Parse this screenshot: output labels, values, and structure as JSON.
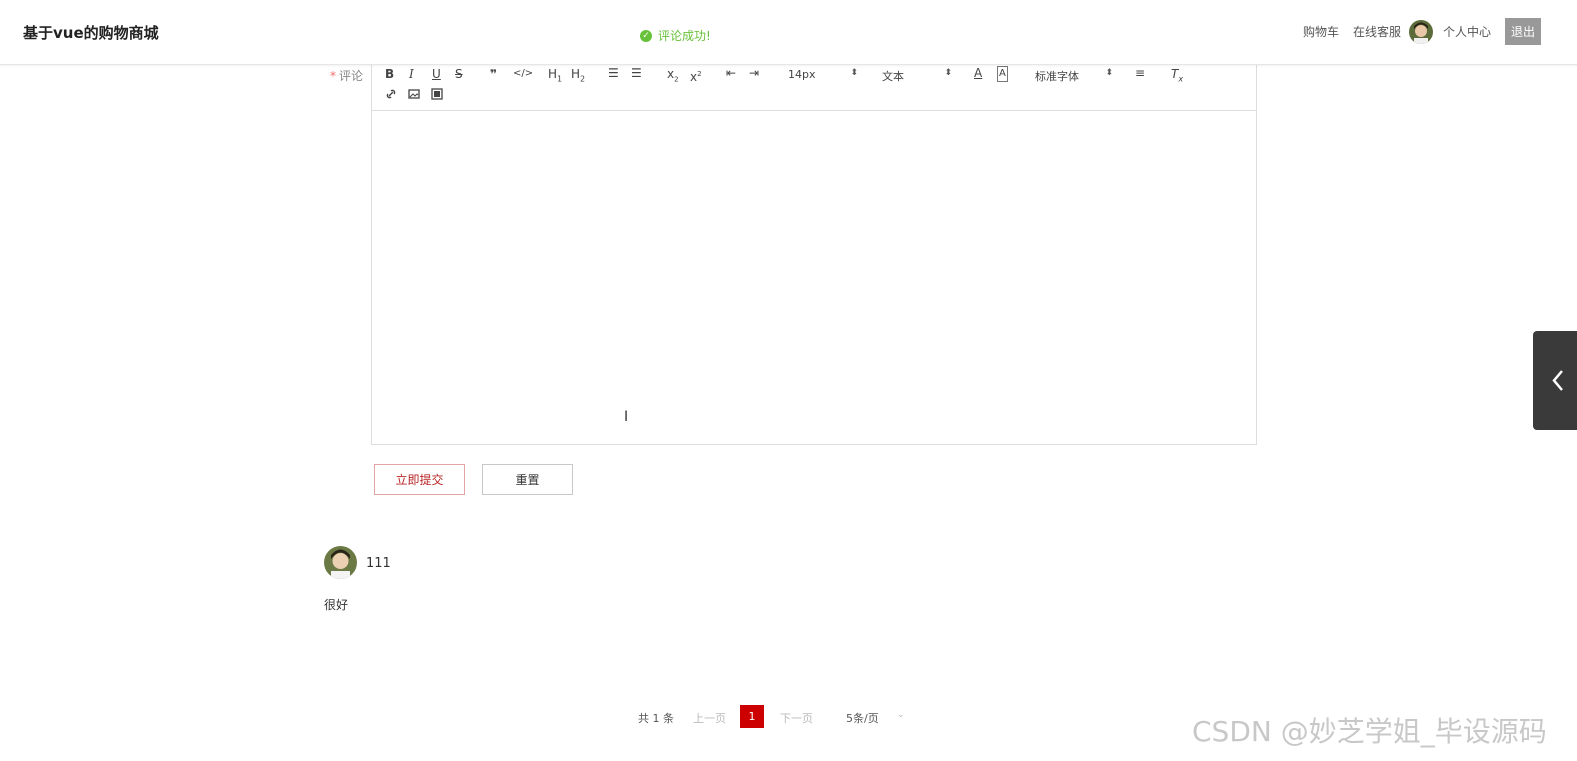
{
  "header": {
    "title": "基于vue的购物商城",
    "toast": "评论成功!",
    "nav": {
      "cart": "购物车",
      "service": "在线客服",
      "profile": "个人中心",
      "logout": "退出"
    }
  },
  "form": {
    "label": "评论",
    "required_mark": "*",
    "toolbar": {
      "size": "14px",
      "header": "文本",
      "font": "标准字体"
    },
    "submit": "立即提交",
    "reset": "重置"
  },
  "comments": [
    {
      "user": "111",
      "text": "很好"
    }
  ],
  "pagination": {
    "total": "共 1 条",
    "prev": "上一页",
    "page": "1",
    "next": "下一页",
    "page_size": "5条/页"
  },
  "watermark": "CSDN @妙芝学姐_毕设源码",
  "colors": {
    "toast": "#67c23a",
    "accent": "#cc0000",
    "required": "#f56c6c"
  }
}
